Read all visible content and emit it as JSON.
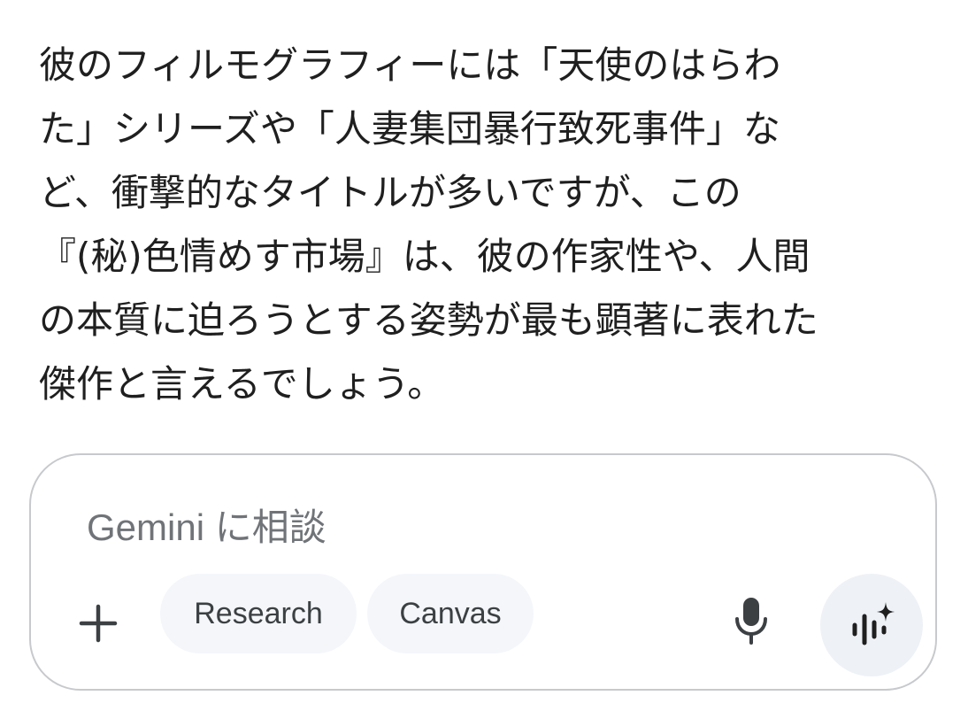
{
  "response": {
    "lines": [
      "彼のフィルモグラフィーには「天使のはらわ",
      "た」シリーズや「人妻集団暴行致死事件」な",
      "ど、衝撃的なタイトルが多いですが、この",
      "『(秘)色情めす市場』は、彼の作家性や、人間",
      "の本質に迫ろうとする姿勢が最も顕著に表れた",
      "傑作と言えるでしょう。"
    ]
  },
  "composer": {
    "placeholder": "Gemini に相談",
    "plus_icon": "plus-icon",
    "chips": {
      "research": "Research",
      "canvas": "Canvas"
    },
    "mic_icon": "microphone-icon",
    "live_icon": "gemini-live-icon"
  },
  "colors": {
    "text": "#1f1f1f",
    "placeholder": "#707478",
    "card_border": "#c7c9cc",
    "chip_bg": "#f4f6fa",
    "live_bg": "#eef1f6"
  }
}
